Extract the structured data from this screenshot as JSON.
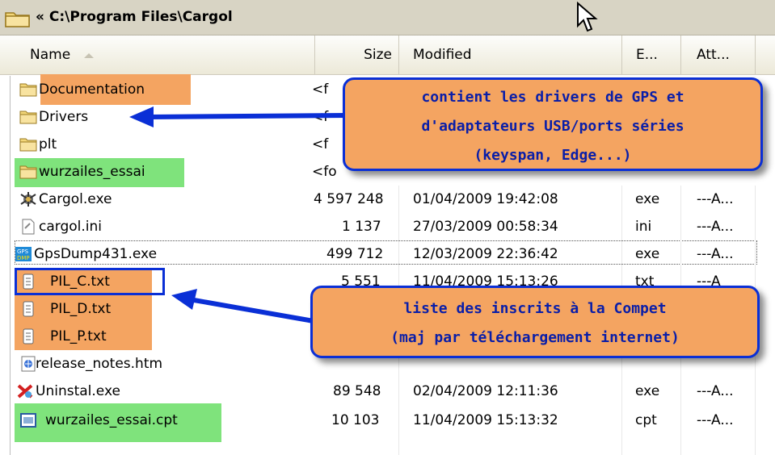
{
  "window": {
    "path": "« C:\\Program Files\\Cargol"
  },
  "header": {
    "name": "Name",
    "size": "Size",
    "modified": "Modified",
    "ext": "E...",
    "attr": "Att..."
  },
  "files": [
    {
      "name": "Documentation",
      "size": "<f",
      "modified": "",
      "ext": "",
      "attr": "",
      "icon": "folder-icon"
    },
    {
      "name": "Drivers",
      "size": "<f",
      "modified": "",
      "ext": "",
      "attr": "",
      "icon": "folder-icon"
    },
    {
      "name": "plt",
      "size": "<f",
      "modified": "",
      "ext": "",
      "attr": "",
      "icon": "folder-icon"
    },
    {
      "name": "wurzailes_essai",
      "size": "<fo",
      "modified": "",
      "ext": "",
      "attr": "",
      "icon": "folder-icon"
    },
    {
      "name": "Cargol.exe",
      "size": "4 597 248",
      "modified": "01/04/2009 19:42:08",
      "ext": "exe",
      "attr": "---A...",
      "icon": "app-icon"
    },
    {
      "name": "cargol.ini",
      "size": "1 137",
      "modified": "27/03/2009 00:58:34",
      "ext": "ini",
      "attr": "---A...",
      "icon": "ini-file-icon"
    },
    {
      "name": "GpsDump431.exe",
      "size": "499 712",
      "modified": "12/03/2009 22:36:42",
      "ext": "exe",
      "attr": "---A...",
      "icon": "gpsdump-icon"
    },
    {
      "name": "PIL_C.txt",
      "size": "5 551",
      "modified": "11/04/2009 15:13:26",
      "ext": "txt",
      "attr": "---A",
      "icon": "text-file-icon"
    },
    {
      "name": "PIL_D.txt",
      "size": "",
      "modified": "",
      "ext": "",
      "attr": "",
      "icon": "text-file-icon"
    },
    {
      "name": "PIL_P.txt",
      "size": "",
      "modified": "",
      "ext": "",
      "attr": "",
      "icon": "text-file-icon"
    },
    {
      "name": "release_notes.htm",
      "size": "",
      "modified": "",
      "ext": "",
      "attr": "",
      "icon": "html-file-icon"
    },
    {
      "name": "Uninstal.exe",
      "size": "89 548",
      "modified": "02/04/2009 12:11:36",
      "ext": "exe",
      "attr": "---A...",
      "icon": "uninstall-icon"
    },
    {
      "name": "wurzailes_essai.cpt",
      "size": "10 103",
      "modified": "11/04/2009 15:13:32",
      "ext": "cpt",
      "attr": "---A...",
      "icon": "cpt-file-icon"
    }
  ],
  "callouts": {
    "drivers": {
      "line1": "contient les drivers de GPS et",
      "line2": "d'adaptateurs USB/ports séries",
      "line3": "(keyspan, Edge...)"
    },
    "pilots": {
      "line1": "liste des inscrits à la Compet",
      "line2": "(maj par téléchargement internet)"
    }
  },
  "colors": {
    "annotation_orange": "#f4a461",
    "annotation_green": "#7fe37c",
    "annotation_blue": "#0a2fd6"
  }
}
